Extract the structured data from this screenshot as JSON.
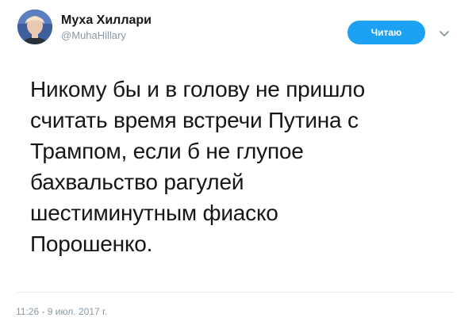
{
  "author": {
    "display_name": "Муха Хиллари",
    "handle": "@MuhaHillary",
    "avatar_icon": "profile-photo"
  },
  "follow_button": {
    "label": "Читаю",
    "color": "#1da1f2"
  },
  "menu_icon": "chevron-down-icon",
  "tweet": {
    "lines": [
      "Никому бы и в голову не пришло",
      "считать время встречи Путина с",
      "Трампом, если б не глупое",
      "бахвальство рагулей",
      "шестиминутным фиаско",
      "Порошенко."
    ],
    "timestamp": "11:26 - 9 июл. 2017 г."
  }
}
